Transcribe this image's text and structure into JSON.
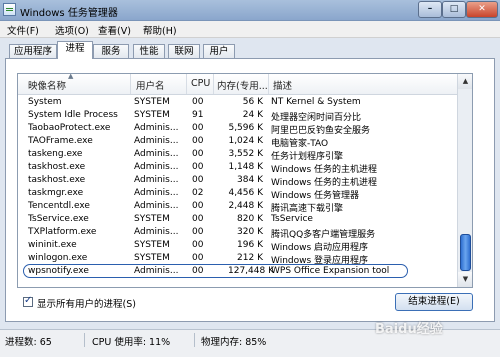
{
  "window": {
    "title": "Windows 任务管理器",
    "buttons": {
      "minimize": "–",
      "maximize": "□",
      "close": "✕"
    }
  },
  "menu": [
    "文件(F)",
    "选项(O)",
    "查看(V)",
    "帮助(H)"
  ],
  "tabs": [
    {
      "label": "应用程序"
    },
    {
      "label": "进程",
      "active": true
    },
    {
      "label": "服务"
    },
    {
      "label": "性能"
    },
    {
      "label": "联网"
    },
    {
      "label": "用户"
    }
  ],
  "columns": {
    "name": "映像名称",
    "user": "用户名",
    "cpu": "CPU",
    "memory": "内存(专用...",
    "description": "描述"
  },
  "processes": [
    {
      "name": "System",
      "user": "SYSTEM",
      "cpu": "00",
      "mem": "56 K",
      "desc": "NT Kernel & System"
    },
    {
      "name": "System Idle Process",
      "user": "SYSTEM",
      "cpu": "91",
      "mem": "24 K",
      "desc": "处理器空闲时间百分比"
    },
    {
      "name": "TaobaoProtect.exe",
      "user": "Adminis...",
      "cpu": "00",
      "mem": "5,596 K",
      "desc": "阿里巴巴反钓鱼安全服务"
    },
    {
      "name": "TAOFrame.exe",
      "user": "Adminis...",
      "cpu": "00",
      "mem": "1,024 K",
      "desc": "电脑管家-TAO"
    },
    {
      "name": "taskeng.exe",
      "user": "Adminis...",
      "cpu": "00",
      "mem": "3,552 K",
      "desc": "任务计划程序引擎"
    },
    {
      "name": "taskhost.exe",
      "user": "Adminis...",
      "cpu": "00",
      "mem": "1,148 K",
      "desc": "Windows 任务的主机进程"
    },
    {
      "name": "taskhost.exe",
      "user": "Adminis...",
      "cpu": "00",
      "mem": "384 K",
      "desc": "Windows 任务的主机进程"
    },
    {
      "name": "taskmgr.exe",
      "user": "Adminis...",
      "cpu": "02",
      "mem": "4,456 K",
      "desc": "Windows 任务管理器"
    },
    {
      "name": "Tencentdl.exe",
      "user": "Adminis...",
      "cpu": "00",
      "mem": "2,448 K",
      "desc": "腾讯高速下载引擎"
    },
    {
      "name": "TsService.exe",
      "user": "SYSTEM",
      "cpu": "00",
      "mem": "820 K",
      "desc": "TsService"
    },
    {
      "name": "TXPlatform.exe",
      "user": "Adminis...",
      "cpu": "00",
      "mem": "320 K",
      "desc": "腾讯QQ多客户端管理服务"
    },
    {
      "name": "wininit.exe",
      "user": "SYSTEM",
      "cpu": "00",
      "mem": "196 K",
      "desc": "Windows 启动应用程序"
    },
    {
      "name": "winlogon.exe",
      "user": "SYSTEM",
      "cpu": "00",
      "mem": "212 K",
      "desc": "Windows 登录应用程序"
    },
    {
      "name": "wpsnotify.exe",
      "user": "Adminis...",
      "cpu": "00",
      "mem": "127,448 K",
      "desc": "WPS Office Expansion tool",
      "selected": true
    }
  ],
  "show_all_users": {
    "label": "显示所有用户的进程(S)",
    "checked": true
  },
  "end_process_button": "结束进程(E)",
  "status": {
    "processes": "进程数: 65",
    "cpu": "CPU 使用率: 11%",
    "memory": "物理内存: 85%"
  },
  "watermark": "Baidu经验"
}
